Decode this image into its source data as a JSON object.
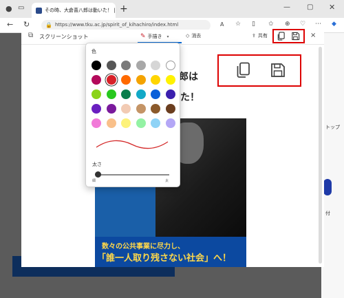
{
  "browser": {
    "tab_title": "その時、大倉喜八郎は動いた！ | 東",
    "tab_close": "×",
    "new_tab": "+",
    "url": "https://www.tku.ac.jp/spirit_of_kihachiro/index.html"
  },
  "screenshot_tool": {
    "title": "スクリーンショット",
    "draw_label": "手描き",
    "erase_label": "消去",
    "share_label": "共有",
    "close_label": "×"
  },
  "palette": {
    "color_label": "色",
    "thickness_label": "太さ",
    "thin_label": "細",
    "thick_label": "太",
    "stroke_color": "#d42a2a",
    "thickness_value": 0.0,
    "colors": [
      "#000000",
      "#575757",
      "#7a7a7a",
      "#a8a8a8",
      "#d6d6d6",
      "#ffffff",
      "#b30a5b",
      "#d72128",
      "#ff6a00",
      "#f4a300",
      "#ffd500",
      "#fff200",
      "#8ad318",
      "#28c81e",
      "#0a7e4c",
      "#12a9c7",
      "#0a5fd9",
      "#3b1fae",
      "#6a1fc0",
      "#7a1a9c",
      "#f2cbb4",
      "#c49466",
      "#8b5a2b",
      "#6b3e1f",
      "#f17ad8",
      "#f9c08a",
      "#fdf27a",
      "#94f2a4",
      "#8fd3f6",
      "#b4a7f6"
    ],
    "selected_index": 7
  },
  "page": {
    "heading_line1": "郎は",
    "heading_line2": "た！",
    "poster_line1": "数々の公共事業に尽力し、",
    "poster_line2": "「誰一人取り残さない社会」へ！",
    "side_label": "トップ",
    "side_label2": "付"
  }
}
